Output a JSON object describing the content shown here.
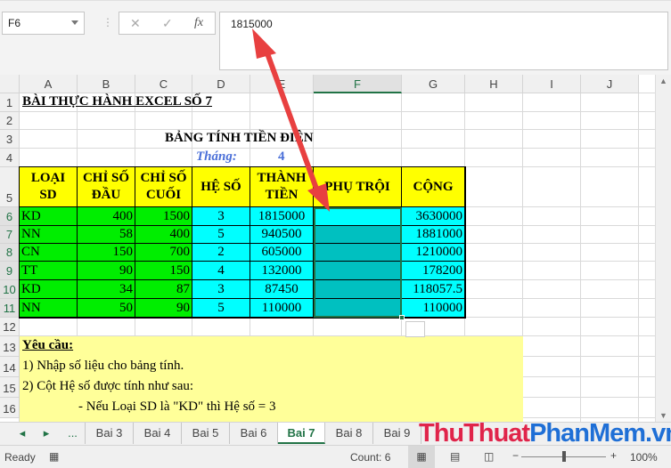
{
  "name_box": "F6",
  "formula_bar": {
    "value": "1815000",
    "cancel_icon": "✕",
    "enter_icon": "✓",
    "fx_label": "fx"
  },
  "columns": [
    "A",
    "B",
    "C",
    "D",
    "E",
    "F",
    "G",
    "H",
    "I",
    "J"
  ],
  "selected_column": "F",
  "rows": [
    "1",
    "2",
    "3",
    "4",
    "5",
    "6",
    "7",
    "8",
    "9",
    "10",
    "11",
    "12",
    "13",
    "14",
    "15",
    "16"
  ],
  "title": "BÀI THỰC HÀNH EXCEL SỐ 7",
  "table_title": "BẢNG TÍNH TIỀN ĐIỆN",
  "month_label": "Tháng:",
  "month_value": "4",
  "headers": [
    "LOẠI SD",
    "CHỈ SỐ ĐẦU",
    "CHỈ SỐ CUỐI",
    "HỆ SỐ",
    "THÀNH TIỀN",
    "PHỤ TRỘI",
    "CỘNG"
  ],
  "table_rows": [
    [
      "KD",
      "400",
      "1500",
      "3",
      "1815000",
      "",
      "3630000"
    ],
    [
      "NN",
      "58",
      "400",
      "5",
      "940500",
      "",
      "1881000"
    ],
    [
      "CN",
      "150",
      "700",
      "2",
      "605000",
      "",
      "1210000"
    ],
    [
      "TT",
      "90",
      "150",
      "4",
      "132000",
      "",
      "178200"
    ],
    [
      "KD",
      "34",
      "87",
      "3",
      "87450",
      "",
      "118057.5"
    ],
    [
      "NN",
      "50",
      "90",
      "5",
      "110000",
      "",
      "110000"
    ]
  ],
  "notes": [
    "Yêu cầu:",
    "1) Nhập số liệu cho bảng tính.",
    "2) Cột Hệ số được tính như sau:",
    "- Nếu Loại SD là \"KD\" thì Hệ số = 3"
  ],
  "sheet_tabs": [
    "Bai 3",
    "Bai 4",
    "Bai 5",
    "Bai 6",
    "Bai 7",
    "Bai 8",
    "Bai 9"
  ],
  "active_tab": "Bai 7",
  "tab_overflow": "...",
  "watermark": "ThuThuatPhanMem.vn",
  "status": {
    "ready": "Ready",
    "count": "Count: 6",
    "zoom": "100%"
  },
  "colors": {
    "header": "#ffff00",
    "green": "#00ee00",
    "cyan": "#00ffff",
    "arrow": "#e84040"
  }
}
